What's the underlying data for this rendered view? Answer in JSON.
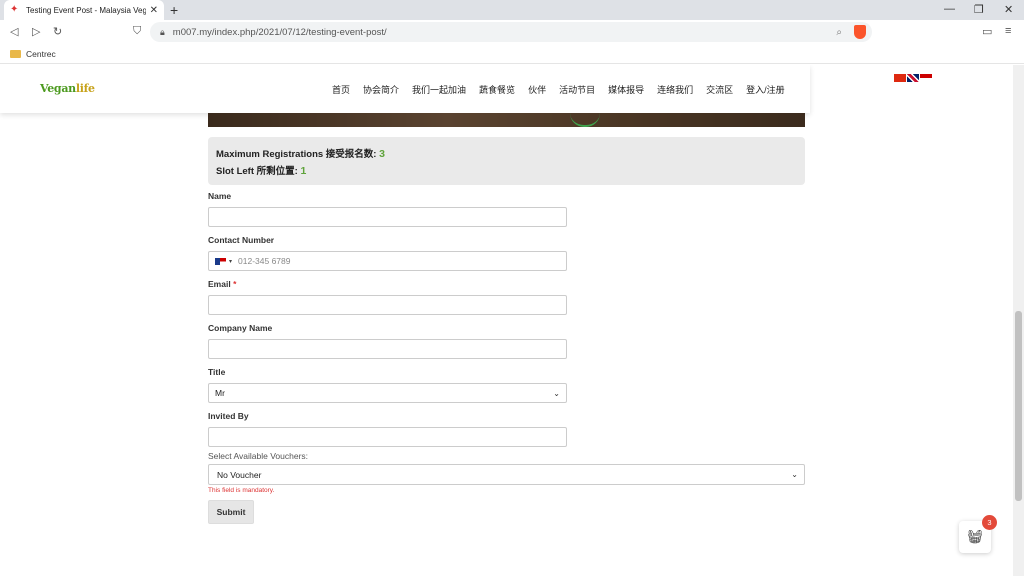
{
  "browser": {
    "tab_title": "Testing Event Post - Malaysia Veg",
    "url": "m007.my/index.php/2021/07/12/testing-event-post/",
    "bookmark_folder": "Centrec"
  },
  "site": {
    "logo_main": "Vegan",
    "logo_accent": "life",
    "nav": [
      "首页",
      "协会简介",
      "我们一起加油",
      "蔬食餐览",
      "伙伴",
      "活动节目",
      "媒体报导",
      "连络我们",
      "交流区",
      "登入/注册"
    ]
  },
  "info": {
    "max_label": "Maximum Registrations 接受报名数:",
    "max_value": "3",
    "slot_label": "Slot Left 所剩位置:",
    "slot_value": "1"
  },
  "form": {
    "name_label": "Name",
    "contact_label": "Contact Number",
    "contact_placeholder": "012-345 6789",
    "email_label": "Email",
    "email_required": "*",
    "company_label": "Company Name",
    "title_label": "Title",
    "title_value": "Mr",
    "invited_label": "Invited By",
    "voucher_label": "Select Available Vouchers:",
    "voucher_value": "No Voucher",
    "voucher_error": "This field is mandatory.",
    "submit_label": "Submit"
  },
  "cart": {
    "count": "3"
  },
  "colors": {
    "accent_green": "#5fa33b",
    "error_red": "#d33333",
    "badge": "#e34a3a"
  }
}
